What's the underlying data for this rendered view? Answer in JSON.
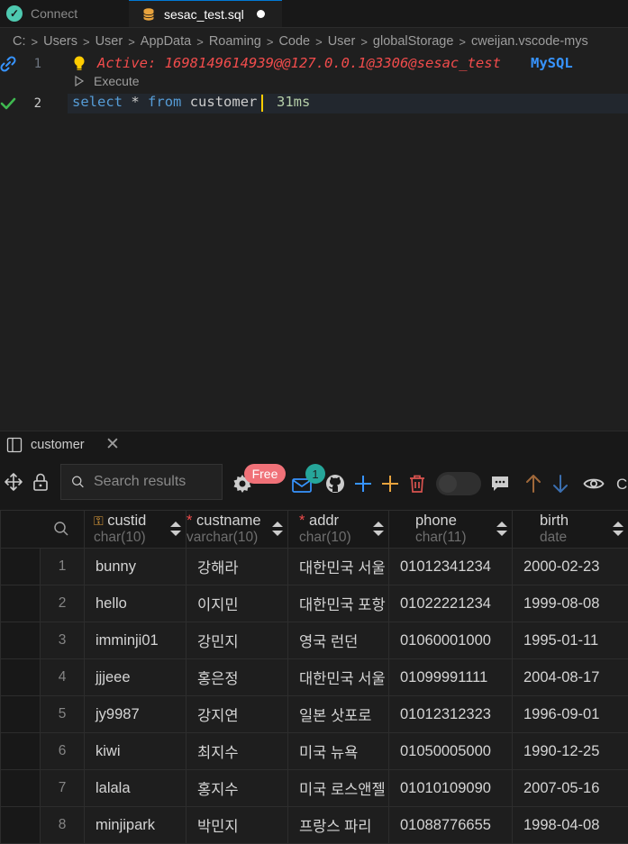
{
  "tabs": [
    {
      "label": "Connect"
    },
    {
      "label": "sesac_test.sql"
    }
  ],
  "breadcrumb": [
    "C:",
    "Users",
    "User",
    "AppData",
    "Roaming",
    "Code",
    "User",
    "globalStorage",
    "cweijan.vscode-mys"
  ],
  "editor": {
    "line1_number": "1",
    "line2_number": "2",
    "active_label": "Active: 1698149614939@@127.0.0.1@3306@sesac_test",
    "db_type": "MySQL",
    "codelens": "Execute",
    "query_select": "select",
    "query_star": "*",
    "query_from": "from",
    "query_table": "customer",
    "exec_time": "31ms"
  },
  "panel": {
    "title": "customer"
  },
  "toolbar": {
    "search_placeholder": "Search results",
    "free_badge": "Free",
    "notification_count": "1",
    "overflow_text": "C"
  },
  "columns": [
    {
      "name": "custid",
      "type": "char(10)",
      "key": true,
      "required": false
    },
    {
      "name": "custname",
      "type": "varchar(10)",
      "key": false,
      "required": true
    },
    {
      "name": "addr",
      "type": "char(10)",
      "key": false,
      "required": true
    },
    {
      "name": "phone",
      "type": "char(11)",
      "key": false,
      "required": false
    },
    {
      "name": "birth",
      "type": "date",
      "key": false,
      "required": false
    }
  ],
  "rows": [
    [
      "1",
      "bunny",
      "강해라",
      "대한민국 서울",
      "01012341234",
      "2000-02-23"
    ],
    [
      "2",
      "hello",
      "이지민",
      "대한민국 포항",
      "01022221234",
      "1999-08-08"
    ],
    [
      "3",
      "imminji01",
      "강민지",
      "영국 런던",
      "01060001000",
      "1995-01-11"
    ],
    [
      "4",
      "jjjeee",
      "홍은정",
      "대한민국 서울",
      "01099991111",
      "2004-08-17"
    ],
    [
      "5",
      "jy9987",
      "강지연",
      "일본 삿포로",
      "01012312323",
      "1996-09-01"
    ],
    [
      "6",
      "kiwi",
      "최지수",
      "미국 뉴욕",
      "01050005000",
      "1990-12-25"
    ],
    [
      "7",
      "lalala",
      "홍지수",
      "미국 로스앤젤",
      "01010109090",
      "2007-05-16"
    ],
    [
      "8",
      "minjipark",
      "박민지",
      "프랑스 파리",
      "01088776655",
      "1998-04-08"
    ]
  ],
  "colors": {
    "accent": "#0078d4",
    "keyword": "#569cd6",
    "active": "#f14c4c",
    "exec_time": "#b5cea8",
    "free_badge": "#f07178",
    "connect_check": "#4ec9b0",
    "plus_blue": "#3794ff",
    "plus_orange": "#e8a33d",
    "trash": "#d9534f"
  }
}
